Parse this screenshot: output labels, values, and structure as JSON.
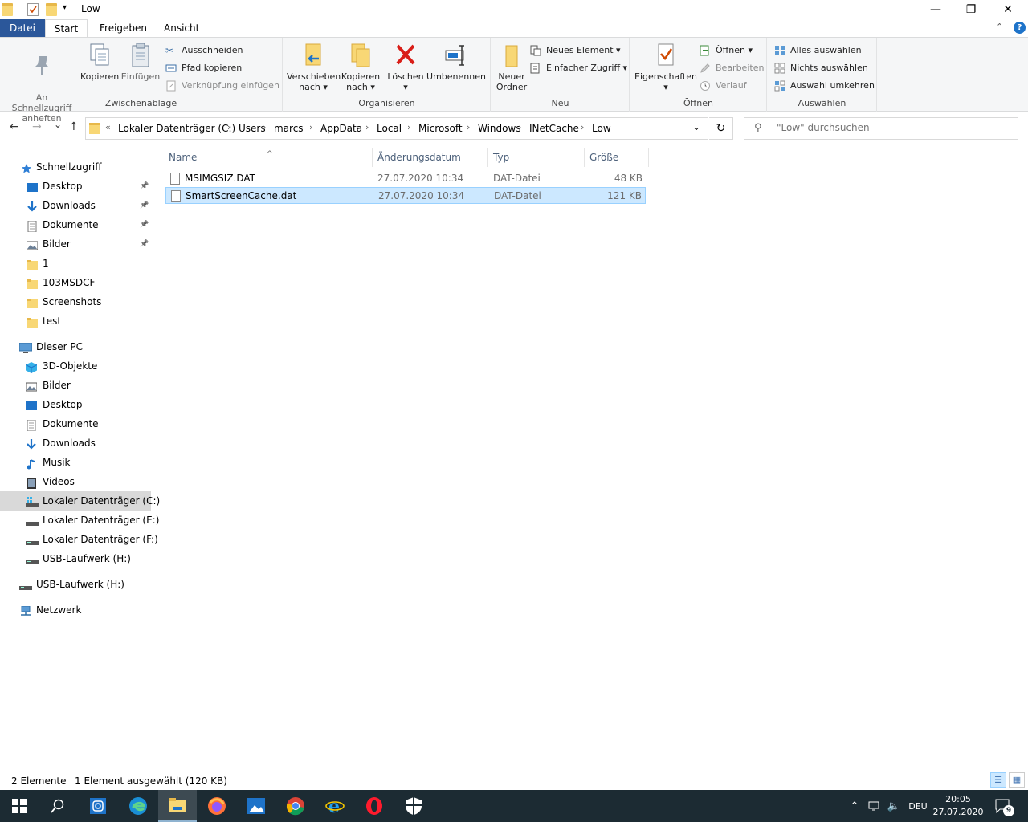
{
  "window": {
    "title": "Low",
    "minimize": "—",
    "maximize": "❐",
    "close": "✕",
    "help": "?",
    "collapse": "⌃"
  },
  "tabs": [
    "Datei",
    "Start",
    "Freigeben",
    "Ansicht"
  ],
  "ribbon": {
    "clipboard": {
      "label": "Zwischenablage",
      "pin": "An Schnellzugriff\nanheften",
      "copy": "Kopieren",
      "paste": "Einfügen",
      "cut": "Ausschneiden",
      "copy_path": "Pfad kopieren",
      "paste_shortcut": "Verknüpfung einfügen"
    },
    "organize": {
      "label": "Organisieren",
      "move_to": "Verschieben",
      "move_to_2": "nach ▾",
      "copy_to": "Kopieren",
      "copy_to_2": "nach ▾",
      "delete": "Löschen",
      "delete_2": "▾",
      "rename": "Umbenennen"
    },
    "new": {
      "label": "Neu",
      "new_folder": "Neuer",
      "new_folder_2": "Ordner",
      "new_item": "Neues Element ▾",
      "easy_access": "Einfacher Zugriff ▾"
    },
    "open": {
      "label": "Öffnen",
      "properties": "Eigenschaften",
      "properties_2": "▾",
      "open": "Öffnen ▾",
      "edit": "Bearbeiten",
      "history": "Verlauf"
    },
    "select": {
      "label": "Auswählen",
      "select_all": "Alles auswählen",
      "select_none": "Nichts auswählen",
      "invert": "Auswahl umkehren"
    }
  },
  "nav": {
    "back": "←",
    "forward": "→",
    "recent": "⌄",
    "up": "↑",
    "refresh": "↻",
    "dropdown": "⌄"
  },
  "breadcrumb": {
    "overflow": "«",
    "items": [
      "Lokaler Datenträger (C:)",
      "Users",
      "marcs",
      "AppData",
      "Local",
      "Microsoft",
      "Windows",
      "INetCache",
      "Low"
    ],
    "sep": "›"
  },
  "search": {
    "icon": "⚲",
    "placeholder": "\"Low\" durchsuchen"
  },
  "navpane": {
    "quick_access": "Schnellzugriff",
    "quick_items": [
      "Desktop",
      "Downloads",
      "Dokumente",
      "Bilder",
      "1",
      "103MSDCF",
      "Screenshots",
      "test"
    ],
    "this_pc": "Dieser PC",
    "pc_items": [
      "3D-Objekte",
      "Bilder",
      "Desktop",
      "Dokumente",
      "Downloads",
      "Musik",
      "Videos",
      "Lokaler Datenträger (C:)",
      "Lokaler Datenträger (E:)",
      "Lokaler Datenträger (F:)",
      "USB-Laufwerk (H:)"
    ],
    "usb": "USB-Laufwerk (H:)",
    "network": "Netzwerk"
  },
  "columns": {
    "name": "Name",
    "date": "Änderungsdatum",
    "type": "Typ",
    "size": "Größe"
  },
  "files": [
    {
      "name": "MSIMGSIZ.DAT",
      "date": "27.07.2020 10:34",
      "type": "DAT-Datei",
      "size": "48 KB"
    },
    {
      "name": "SmartScreenCache.dat",
      "date": "27.07.2020 10:34",
      "type": "DAT-Datei",
      "size": "121 KB"
    }
  ],
  "status": {
    "count": "2 Elemente",
    "selection": "1 Element ausgewählt (120 KB)"
  },
  "tray": {
    "lang": "DEU",
    "time": "20:05",
    "date": "27.07.2020",
    "notifications": "9"
  },
  "colors": {
    "accent": "#2b579a",
    "selection": "#cce8ff",
    "taskbar": "#1c2b33"
  }
}
